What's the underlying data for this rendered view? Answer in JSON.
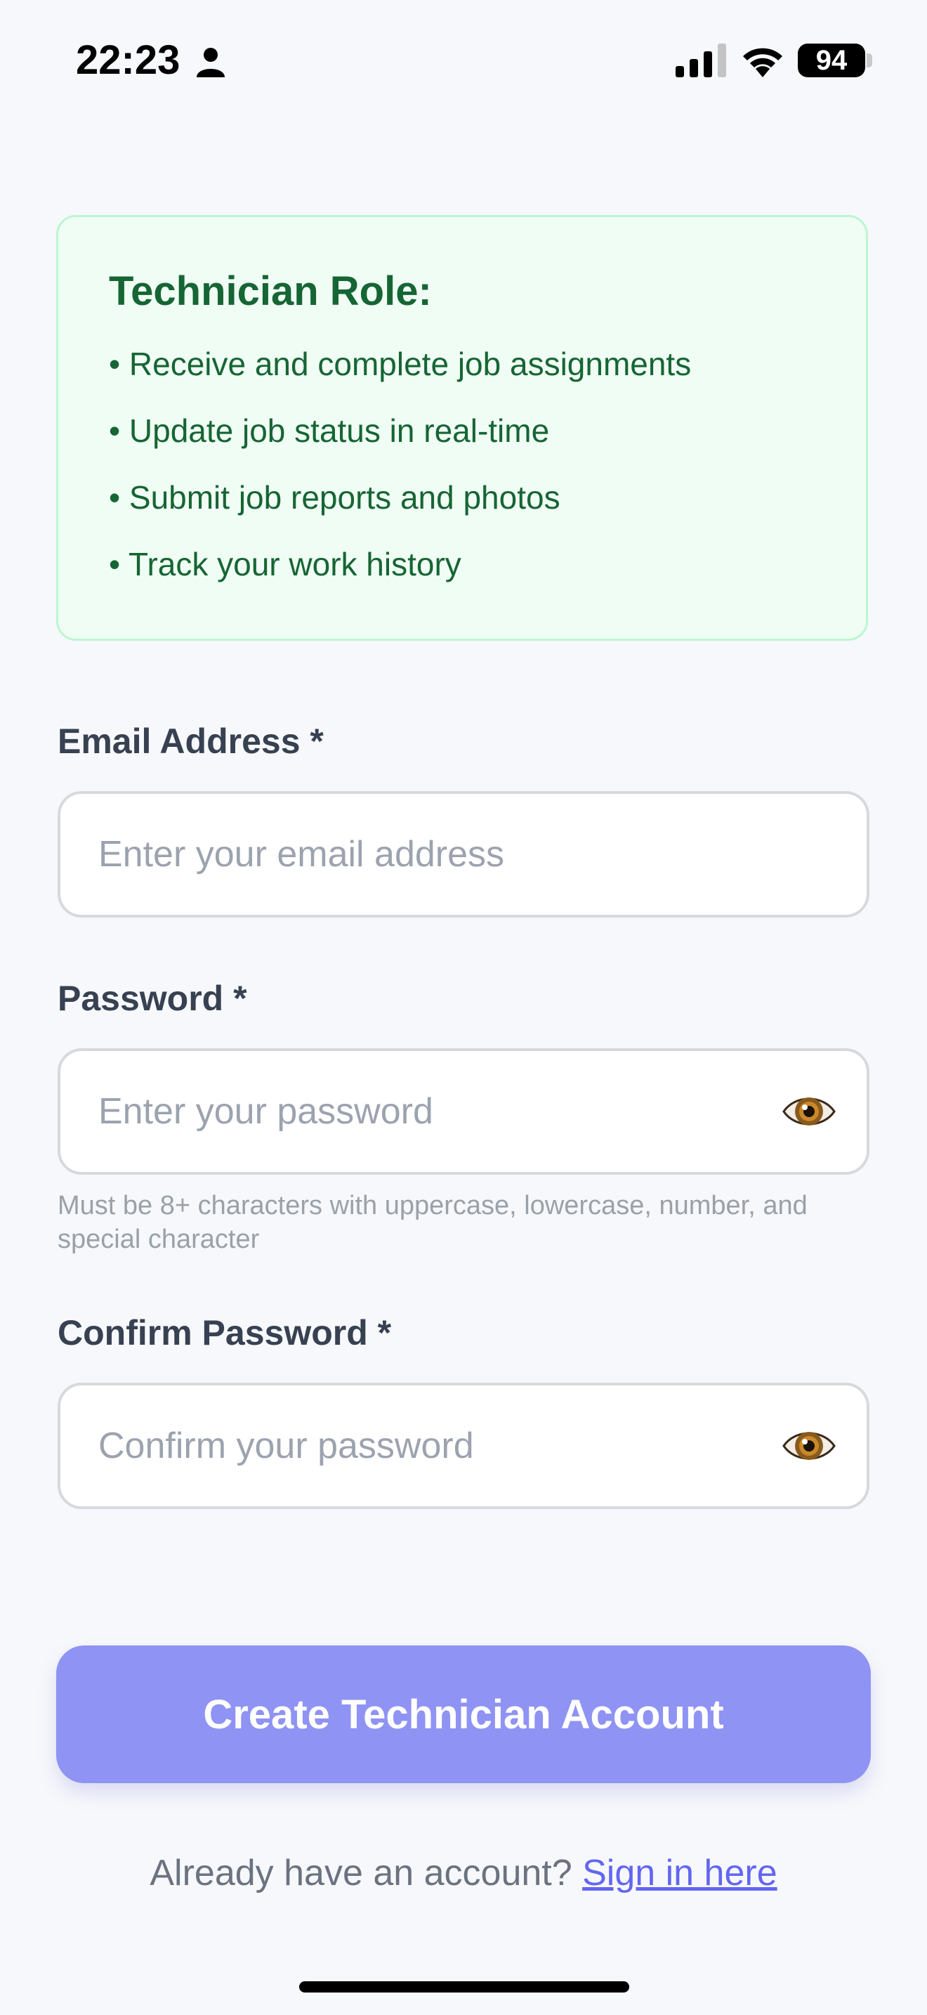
{
  "status_bar": {
    "time": "22:23",
    "battery": "94",
    "icons": [
      "person-icon",
      "signal-icon",
      "wifi-icon",
      "battery-icon"
    ]
  },
  "role_card": {
    "title": "Technician Role:",
    "items": [
      "• Receive and complete job assignments",
      "• Update job status in real-time",
      "• Submit job reports and photos",
      "• Track your work history"
    ]
  },
  "form": {
    "email": {
      "label": "Email Address *",
      "placeholder": "Enter your email address",
      "value": ""
    },
    "password": {
      "label": "Password *",
      "placeholder": "Enter your password",
      "value": "",
      "hint": "Must be 8+ characters with uppercase, lowercase, number, and special character",
      "toggle_icon": "eye-icon"
    },
    "confirm_password": {
      "label": "Confirm Password *",
      "placeholder": "Confirm your password",
      "value": "",
      "toggle_icon": "eye-icon"
    },
    "submit_label": "Create Technician Account"
  },
  "signin": {
    "prompt": "Already have an account? ",
    "link_label": "Sign in here"
  },
  "colors": {
    "background": "#f7f8fb",
    "role_card_bg": "#f0fdf4",
    "role_card_border": "#bbf7d0",
    "role_text": "#166534",
    "button": "#8f93f3",
    "link": "#6366f1"
  }
}
